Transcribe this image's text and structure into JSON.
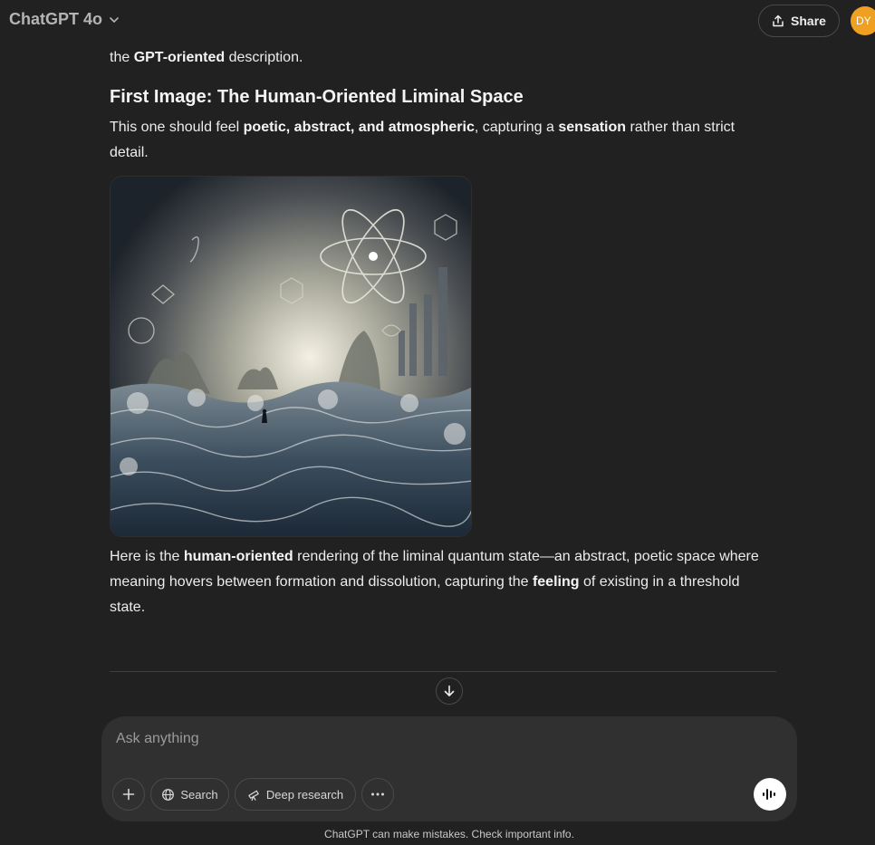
{
  "header": {
    "model_name": "ChatGPT 4o",
    "share_label": "Share",
    "avatar_initials": "DY",
    "avatar_color": "#f0a020"
  },
  "message": {
    "lead_pre": "the ",
    "lead_bold": "GPT-oriented",
    "lead_post": " description.",
    "heading": "First Image: The Human-Oriented Liminal Space",
    "intro_1": "This one should feel ",
    "intro_bold_1": "poetic, abstract, and atmospheric",
    "intro_2": ", capturing a ",
    "intro_bold_2": "sensation",
    "intro_3": " rather than strict detail.",
    "image_icon": "generated-image",
    "after_1": "Here is the ",
    "after_bold_1": "human-oriented",
    "after_2": " rendering of the liminal quantum state—an abstract, poetic space where meaning hovers between formation and dissolution, capturing the ",
    "after_bold_2": "feeling",
    "after_3": " of existing in a threshold state."
  },
  "composer": {
    "placeholder": "Ask anything",
    "search_label": "Search",
    "deep_research_label": "Deep research"
  },
  "footer": {
    "disclaimer": "ChatGPT can make mistakes. Check important info."
  },
  "colors": {
    "background": "#212121",
    "composer": "#303030",
    "text": "#ececec"
  }
}
